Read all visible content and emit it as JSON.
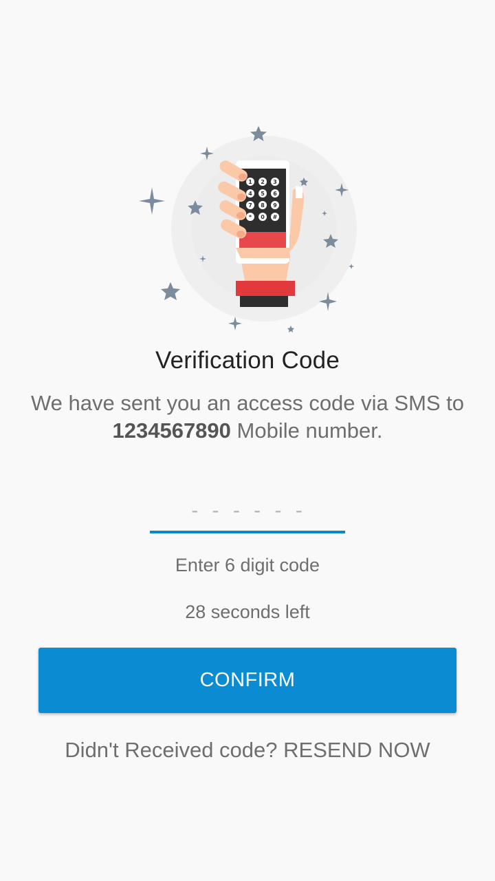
{
  "verify": {
    "title": "Verification Code",
    "message_prefix": "We have sent you an access code via SMS to ",
    "phone_number": "1234567890",
    "message_suffix": " Mobile number.",
    "code_placeholder": "- - - - - -",
    "hint": "Enter 6 digit code",
    "timer": "28 seconds left",
    "confirm_label": "CONFIRM",
    "resend_prefix": "Didn't Received code? ",
    "resend_label": "RESEND NOW"
  },
  "keypad": [
    "1",
    "2",
    "3",
    "4",
    "5",
    "6",
    "7",
    "8",
    "9",
    "*",
    "0",
    "#"
  ],
  "colors": {
    "accent": "#0a8bd2",
    "underline": "#0a88c9",
    "star": "#7b8c9c",
    "phone_red": "#e8474b",
    "cuff_red": "#e2393d",
    "skin": "#fcc9a8"
  },
  "icons": [
    "phone-in-hand-illustration",
    "star-icon",
    "sparkle-icon"
  ]
}
